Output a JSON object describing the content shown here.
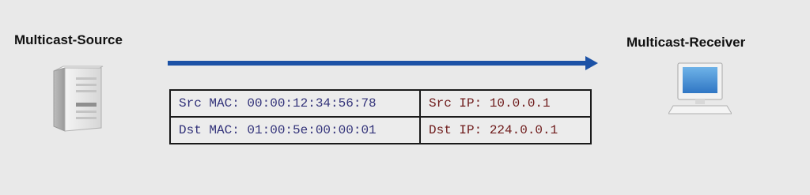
{
  "source": {
    "label": "Multicast-Source"
  },
  "receiver": {
    "label": "Multicast-Receiver"
  },
  "headers": {
    "src_mac": "Src MAC: 00:00:12:34:56:78",
    "dst_mac": "Dst MAC: 01:00:5e:00:00:01",
    "src_ip": "Src IP: 10.0.0.1",
    "dst_ip": "Dst IP: 224.0.0.1"
  },
  "colors": {
    "background": "#e9e9e9",
    "arrow": "#1c52a6",
    "mac_text": "#33337a",
    "ip_text": "#6e1a1a"
  },
  "icons": [
    "server-icon",
    "computer-icon",
    "arrow-right-icon"
  ]
}
